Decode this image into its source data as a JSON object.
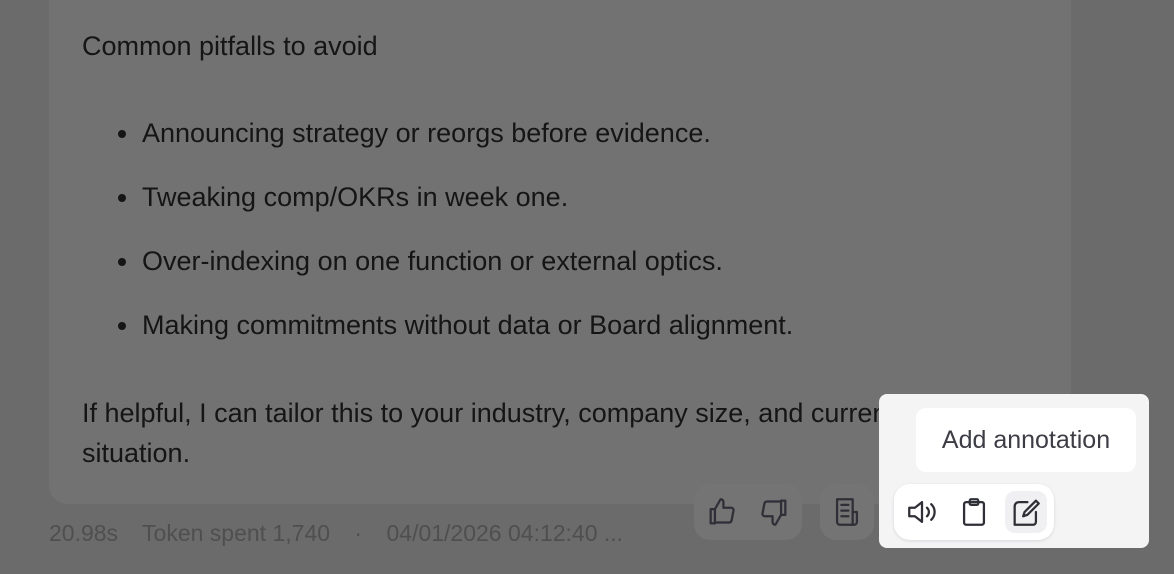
{
  "message": {
    "heading": "Common pitfalls to avoid",
    "bullets": [
      "Announcing strategy or reorgs before evidence.",
      "Tweaking comp/OKRs in week one.",
      "Over-indexing on one function or external optics.",
      "Making commitments without data or Board alignment."
    ],
    "closing_line1": "If helpful, I can tailor this to your industry, company size, and current",
    "closing_line2": "situation."
  },
  "meta": {
    "duration": "20.98s",
    "tokens": "Token spent 1,740",
    "separator": "·",
    "timestamp": "04/01/2026 04:12:40 ..."
  },
  "actions": {
    "tooltip": "Add annotation",
    "icons": [
      "thumbs-up-icon",
      "thumbs-down-icon",
      "document-icon",
      "speaker-icon",
      "clipboard-icon",
      "edit-annotation-icon"
    ]
  },
  "colors": {
    "overlay": "#6b6b6b",
    "card": "#727272",
    "popup": "#f4f4f5",
    "icon": "#2f2f37"
  }
}
